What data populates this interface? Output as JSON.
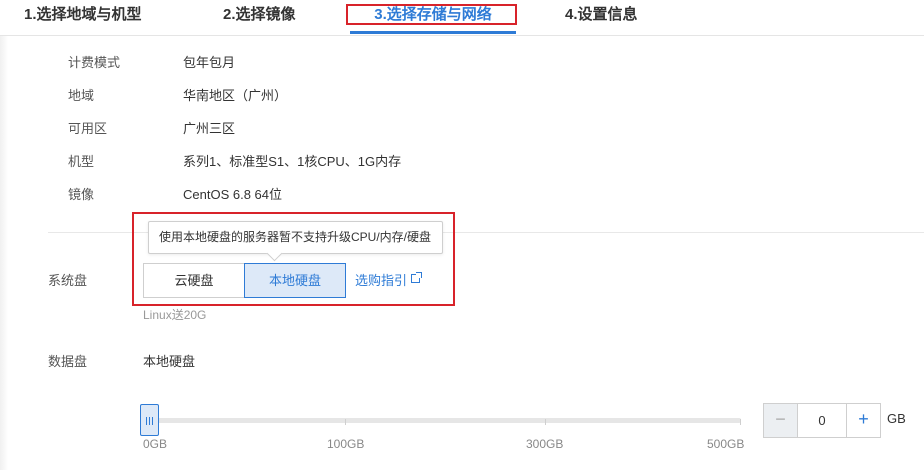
{
  "steps": [
    {
      "label": "1.选择地域与机型"
    },
    {
      "label": "2.选择镜像"
    },
    {
      "label": "3.选择存储与网络",
      "active": true
    },
    {
      "label": "4.设置信息"
    }
  ],
  "summary": [
    {
      "label": "计费模式",
      "value": "包年包月"
    },
    {
      "label": "地域",
      "value": "华南地区（广州）"
    },
    {
      "label": "可用区",
      "value": "广州三区"
    },
    {
      "label": "机型",
      "value": "系列1、标准型S1、1核CPU、1G内存"
    },
    {
      "label": "镜像",
      "value": "CentOS 6.8 64位"
    }
  ],
  "system_disk": {
    "label": "系统盘",
    "tooltip": "使用本地硬盘的服务器暂不支持升级CPU/内存/硬盘",
    "options": [
      "云硬盘",
      "本地硬盘"
    ],
    "selected": "本地硬盘",
    "guide_link": "选购指引",
    "note": "Linux送20G"
  },
  "data_disk": {
    "label": "数据盘",
    "type": "本地硬盘",
    "slider_ticks": [
      "0GB",
      "100GB",
      "300GB",
      "500GB"
    ],
    "value": "0",
    "unit": "GB",
    "minus": "−",
    "plus": "+"
  },
  "colors": {
    "accent": "#2e7bd6",
    "highlight_border": "#d8232a"
  }
}
